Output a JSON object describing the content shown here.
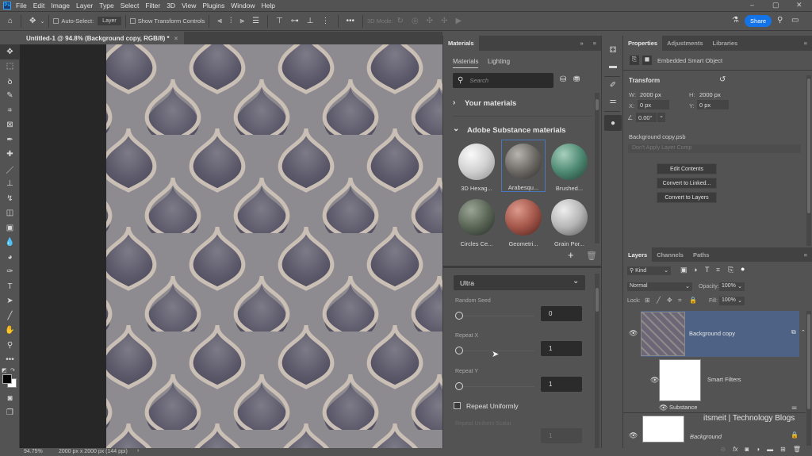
{
  "app": {
    "logo": "Ps"
  },
  "menu": [
    "File",
    "Edit",
    "Image",
    "Layer",
    "Type",
    "Select",
    "Filter",
    "3D",
    "View",
    "Plugins",
    "Window",
    "Help"
  ],
  "window_controls": {
    "minimize": "–",
    "restore": "▢",
    "close": "✕"
  },
  "options_bar": {
    "auto_select_label": "Auto-Select:",
    "auto_select_value": "Layer",
    "show_transform_label": "Show Transform Controls",
    "three_d_mode_label": "3D Mode:",
    "more_label": "•••",
    "share_label": "Share"
  },
  "document_tab": {
    "title": "Untitled-1 @ 94.8% (Background copy, RGB/8) *",
    "close": "×"
  },
  "status_bar": {
    "zoom": "94.75%",
    "doc_info": "2000 px x 2000 px (144 ppi)"
  },
  "tools": [
    "move",
    "marquee",
    "lasso",
    "quick-select",
    "crop",
    "frame",
    "eyedropper",
    "healing",
    "brush",
    "stamp",
    "history-brush",
    "eraser",
    "gradient",
    "blur",
    "dodge",
    "pen",
    "type",
    "path-select",
    "line",
    "hand",
    "zoom",
    "more"
  ],
  "materials_panel": {
    "tab": "Materials",
    "subtabs": [
      "Materials",
      "Lighting"
    ],
    "search_placeholder": "Search",
    "your_materials": "Your materials",
    "adobe_section": "Adobe Substance materials",
    "materials": [
      {
        "label": "3D Hexag...",
        "color": "#d9d9d9"
      },
      {
        "label": "Arabesqu...",
        "color": "#6e6a66",
        "selected": true
      },
      {
        "label": "Brushed...",
        "color": "#4f8a73"
      },
      {
        "label": "Circles Ce...",
        "color": "#5b6657"
      },
      {
        "label": "Geometri...",
        "color": "#a4564a"
      },
      {
        "label": "Grain Por...",
        "color": "#b5b5b5"
      }
    ],
    "add_icon": "+",
    "quality_value": "Ultra",
    "params": [
      {
        "label": "Random Seed",
        "value": "0",
        "fraction": 0
      },
      {
        "label": "Repeat X",
        "value": "1",
        "fraction": 0
      },
      {
        "label": "Repeat Y",
        "value": "1",
        "fraction": 0
      }
    ],
    "repeat_uniformly_label": "Repeat Uniformly",
    "repeat_uniformly_checked": false,
    "repeat_uniform_scalar_label": "Repeat Uniform Scalar",
    "repeat_uniform_scalar_value": "1"
  },
  "properties_panel": {
    "tabs": [
      "Properties",
      "Adjustments",
      "Libraries"
    ],
    "object_type": "Embedded Smart Object",
    "transform_label": "Transform",
    "w_label": "W:",
    "w_value": "2000 px",
    "h_label": "H:",
    "h_value": "2000 px",
    "x_label": "X:",
    "x_value": "0 px",
    "y_label": "Y:",
    "y_value": "0 px",
    "angle_value": "0.00°",
    "filename": "Background copy.psb",
    "layer_comp_placeholder": "Don't Apply Layer Comp",
    "buttons": [
      "Edit Contents",
      "Convert to Linked...",
      "Convert to Layers"
    ]
  },
  "layers_panel": {
    "tabs": [
      "Layers",
      "Channels",
      "Paths"
    ],
    "filter_kind": "Kind",
    "blend_mode": "Normal",
    "opacity_label": "Opacity:",
    "opacity_value": "100%",
    "lock_label": "Lock:",
    "fill_label": "Fill:",
    "fill_value": "100%",
    "layers": [
      {
        "name": "Background copy",
        "selected": true
      },
      {
        "name": "Smart Filters"
      },
      {
        "name": "Substance"
      },
      {
        "name": "Background",
        "italic": true
      }
    ],
    "watermark": "itsmeit | Technology Blogs",
    "footer_icons": [
      "link",
      "fx",
      "mask",
      "adjustment",
      "group",
      "new-layer",
      "delete"
    ]
  }
}
